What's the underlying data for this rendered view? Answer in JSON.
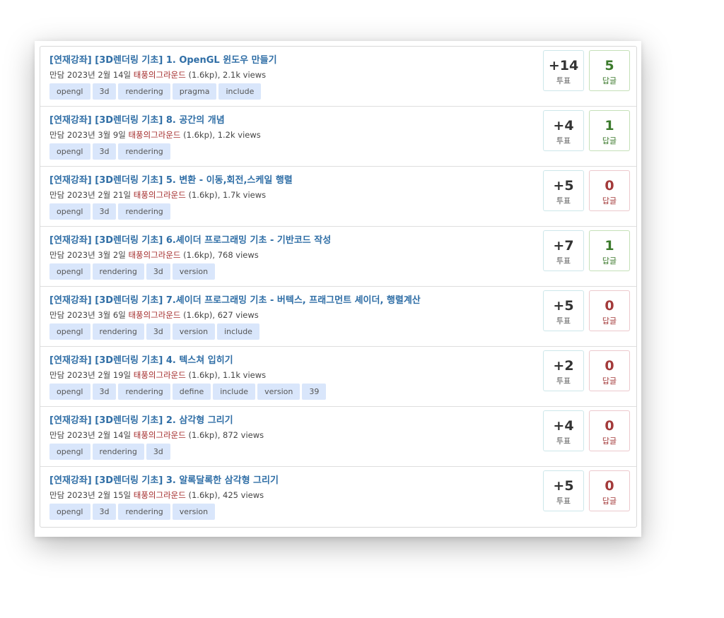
{
  "questions": [
    {
      "title": "[연재강좌] [3D렌더링 기초] 1. OpenGL 윈도우 만들기",
      "category": "만담",
      "date": "2023년 2월 14일",
      "author": "태풍의그라운드",
      "points": "(1.6kp)",
      "views": ", 2.1k views",
      "tags": [
        "opengl",
        "3d",
        "rendering",
        "pragma",
        "include"
      ],
      "votes": "+14",
      "votes_label": "투표",
      "answers": "5",
      "answers_label": "답글",
      "has_answers": true
    },
    {
      "title": "[연재강좌] [3D렌더링 기초] 8. 공간의 개념",
      "category": "만담",
      "date": "2023년 3월 9일",
      "author": "태풍의그라운드",
      "points": "(1.6kp)",
      "views": ", 1.2k views",
      "tags": [
        "opengl",
        "3d",
        "rendering"
      ],
      "votes": "+4",
      "votes_label": "투표",
      "answers": "1",
      "answers_label": "답글",
      "has_answers": true
    },
    {
      "title": "[연재강좌] [3D렌더링 기초] 5. 변환 - 이동,회전,스케일 행렬",
      "category": "만담",
      "date": "2023년 2월 21일",
      "author": "태풍의그라운드",
      "points": "(1.6kp)",
      "views": ", 1.7k views",
      "tags": [
        "opengl",
        "3d",
        "rendering"
      ],
      "votes": "+5",
      "votes_label": "투표",
      "answers": "0",
      "answers_label": "답글",
      "has_answers": false
    },
    {
      "title": "[연재강좌] [3D렌더링 기초] 6.셰이더 프로그래밍 기초 - 기반코드 작성",
      "category": "만담",
      "date": "2023년 3월 2일",
      "author": "태풍의그라운드",
      "points": "(1.6kp)",
      "views": ", 768 views",
      "tags": [
        "opengl",
        "rendering",
        "3d",
        "version"
      ],
      "votes": "+7",
      "votes_label": "투표",
      "answers": "1",
      "answers_label": "답글",
      "has_answers": true
    },
    {
      "title": "[연재강좌] [3D렌더링 기초] 7.셰이더 프로그래밍 기초 - 버텍스, 프래그먼트 셰이더, 행렬계산",
      "category": "만담",
      "date": "2023년 3월 6일",
      "author": "태풍의그라운드",
      "points": "(1.6kp)",
      "views": ", 627 views",
      "tags": [
        "opengl",
        "rendering",
        "3d",
        "version",
        "include"
      ],
      "votes": "+5",
      "votes_label": "투표",
      "answers": "0",
      "answers_label": "답글",
      "has_answers": false
    },
    {
      "title": "[연재강좌] [3D렌더링 기초] 4. 텍스쳐 입히기",
      "category": "만담",
      "date": "2023년 2월 19일",
      "author": "태풍의그라운드",
      "points": "(1.6kp)",
      "views": ", 1.1k views",
      "tags": [
        "opengl",
        "3d",
        "rendering",
        "define",
        "include",
        "version",
        "39"
      ],
      "votes": "+2",
      "votes_label": "투표",
      "answers": "0",
      "answers_label": "답글",
      "has_answers": false
    },
    {
      "title": "[연재강좌] [3D렌더링 기초] 2. 삼각형 그리기",
      "category": "만담",
      "date": "2023년 2월 14일",
      "author": "태풍의그라운드",
      "points": "(1.6kp)",
      "views": ", 872 views",
      "tags": [
        "opengl",
        "rendering",
        "3d"
      ],
      "votes": "+4",
      "votes_label": "투표",
      "answers": "0",
      "answers_label": "답글",
      "has_answers": false
    },
    {
      "title": "[연재강좌] [3D렌더링 기초] 3. 알록달록한 삼각형 그리기",
      "category": "만담",
      "date": "2023년 2월 15일",
      "author": "태풍의그라운드",
      "points": "(1.6kp)",
      "views": ", 425 views",
      "tags": [
        "opengl",
        "3d",
        "rendering",
        "version"
      ],
      "votes": "+5",
      "votes_label": "투표",
      "answers": "0",
      "answers_label": "답글",
      "has_answers": false
    }
  ],
  "colors": {
    "title_link": "#2f6ea6",
    "author": "#a32a2a",
    "tag_bg": "#d9e6fb",
    "answers_positive": "#3c7a2c",
    "answers_zero": "#a33a3a"
  }
}
